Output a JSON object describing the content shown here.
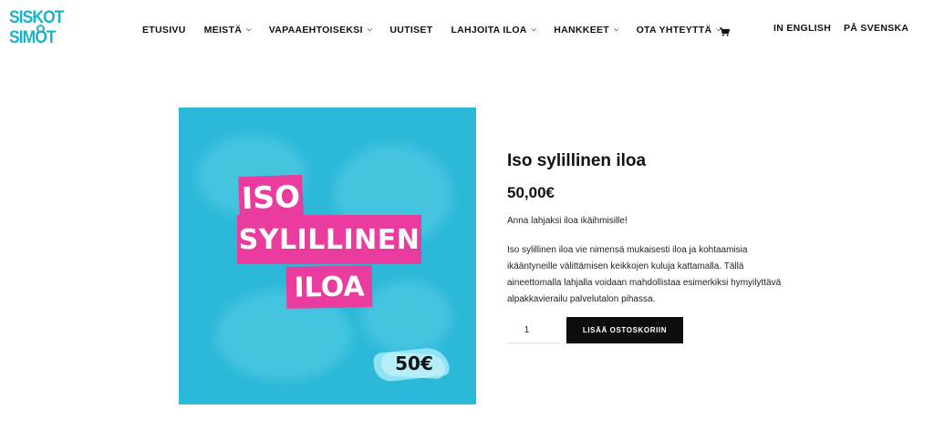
{
  "brand": {
    "logo_line1": "SISKOT",
    "logo_line2": "SIMOT",
    "color": "#19b2c9"
  },
  "nav": {
    "items": [
      {
        "label": "ETUSIVU",
        "has_dropdown": false
      },
      {
        "label": "MEISTÄ",
        "has_dropdown": true
      },
      {
        "label": "VAPAAEHTOISEKSI",
        "has_dropdown": true
      },
      {
        "label": "UUTISET",
        "has_dropdown": false
      },
      {
        "label": "LAHJOITA ILOA",
        "has_dropdown": true
      },
      {
        "label": "HANKKEET",
        "has_dropdown": true
      },
      {
        "label": "OTA YHTEYTTÄ",
        "has_dropdown": true
      }
    ],
    "cart_icon": "cart-icon",
    "lang_english": "IN ENGLISH",
    "lang_swedish": "PÅ SVENSKA"
  },
  "product": {
    "image": {
      "line1": "ISO",
      "line2": "SYLILLINEN",
      "line3": "ILOA",
      "price_tag": "50€",
      "background_color": "#2cb8d8",
      "highlight_color": "#ea3c9e"
    },
    "title": "Iso sylillinen iloa",
    "price": "50,00€",
    "short_description": "Anna lahjaksi iloa ikäihmisille!",
    "description_lines": [
      "Iso sylillinen iloa vie nimensä mukaisesti iloa ja kohtaamisia",
      "ikääntyneille välittämisen keikkojen kuluja kattamalla. Tällä",
      "aineettomalla lahjalla voidaan mahdollistaa esimerkiksi hymyilyttävä",
      "alpakkavierailu palvelutalon pihassa."
    ],
    "quantity": "1",
    "add_to_cart_label": "LISÄÄ OSTOSKORIIN"
  }
}
